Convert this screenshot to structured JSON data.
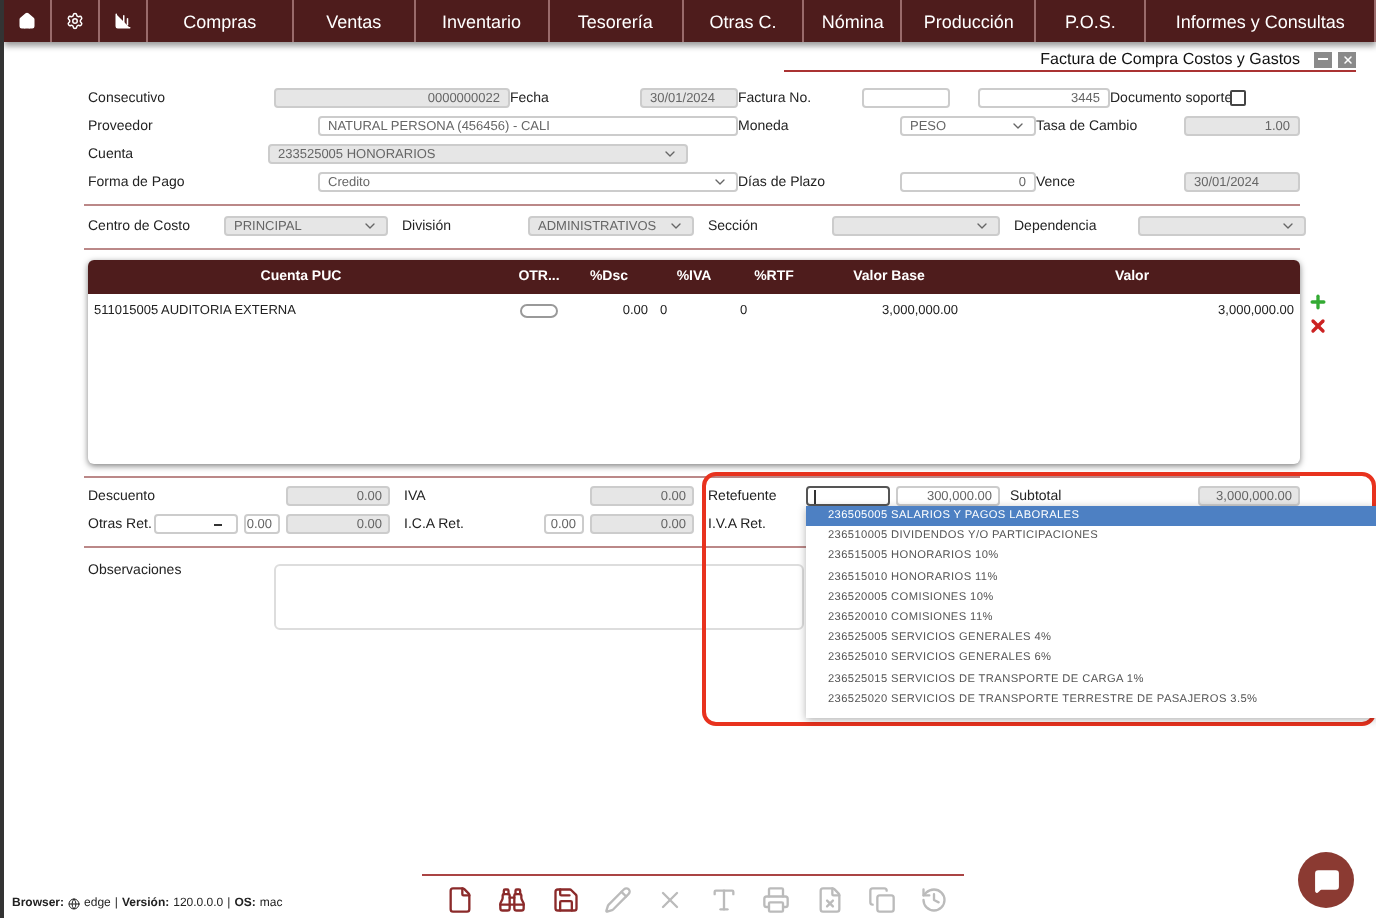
{
  "nav": {
    "items": [
      {
        "label": "Compras"
      },
      {
        "label": "Ventas"
      },
      {
        "label": "Inventario"
      },
      {
        "label": "Tesorería"
      },
      {
        "label": "Otras C."
      },
      {
        "label": "Nómina"
      },
      {
        "label": "Producción"
      },
      {
        "label": "P.O.S."
      },
      {
        "label": "Informes y Consultas"
      }
    ]
  },
  "window": {
    "title": "Factura de Compra Costos y Gastos"
  },
  "header_rows": [
    [
      {
        "kind": "label",
        "text": "Consecutivo"
      },
      {
        "kind": "input",
        "value": "0000000022",
        "disabled": true
      },
      {
        "kind": "label",
        "text": "Fecha"
      },
      {
        "kind": "input",
        "value": "30/01/2024",
        "disabled": true
      },
      {
        "kind": "label",
        "text": "Factura No."
      },
      {
        "kind": "input",
        "disabled": false
      },
      {
        "kind": "input",
        "value": "3445",
        "disabled": false
      },
      {
        "kind": "label",
        "text": "Documento soporte"
      },
      {
        "kind": "checkbox",
        "checked": false
      }
    ],
    [
      {
        "kind": "label",
        "text": "Proveedor"
      },
      {
        "kind": "input",
        "value": "NATURAL  PERSONA  (456456) - CALI",
        "disabled": false
      },
      {
        "kind": "label",
        "text": "Moneda"
      },
      {
        "kind": "select",
        "value": "PESO",
        "disabled": false
      },
      {
        "kind": "label",
        "text": "Tasa de Cambio"
      },
      {
        "kind": "input",
        "value": "1.00",
        "disabled": true
      }
    ],
    [
      {
        "kind": "label",
        "text": "Cuenta"
      },
      {
        "kind": "select",
        "value": "233525005 HONORARIOS",
        "disabled": true
      }
    ],
    [
      {
        "kind": "label",
        "text": "Forma de Pago"
      },
      {
        "kind": "select",
        "value": "Credito",
        "disabled": false
      },
      {
        "kind": "label",
        "text": "Días de Plazo"
      },
      {
        "kind": "input",
        "value": "0",
        "disabled": false
      },
      {
        "kind": "label",
        "text": "Vence"
      },
      {
        "kind": "input",
        "value": "30/01/2024",
        "disabled": true
      }
    ]
  ],
  "cost_row": [
    {
      "label": "Centro de Costo",
      "value": "PRINCIPAL"
    },
    {
      "label": "División",
      "value": "ADMINISTRATIVOS"
    },
    {
      "label": "Sección"
    },
    {
      "label": "Dependencia"
    }
  ],
  "table": {
    "columns": [
      "Cuenta PUC",
      "OTR...",
      "%Dsc",
      "%IVA",
      "%RTF",
      "Valor Base",
      "Valor"
    ],
    "rows": [
      [
        "511015005 AUDITORIA EXTERNA",
        "",
        "0.00",
        "0",
        "0",
        "3,000,000.00",
        "3,000,000.00"
      ]
    ]
  },
  "totals": {
    "descuento": {
      "label": "Descuento",
      "value": "0.00"
    },
    "iva": {
      "label": "IVA",
      "value": "0.00"
    },
    "otras_ret": {
      "label": "Otras Ret.",
      "percent": "0.00",
      "value": "0.00"
    },
    "ica_ret": {
      "label": "I.C.A Ret.",
      "percent": "0.00",
      "value": "0.00"
    },
    "retefuente": {
      "label": "Retefuente",
      "value": "300,000.00"
    },
    "iva_ret": {
      "label": "I.V.A Ret."
    },
    "subtotal": {
      "label": "Subtotal",
      "value": "3,000,000.00"
    }
  },
  "observaciones": {
    "label": "Observaciones"
  },
  "dropdown": [
    {
      "label": "236505005 SALARIOS Y PAGOS LABORALES",
      "selected": true
    },
    {
      "label": "236510005 DIVIDENDOS Y/O PARTICIPACIONES",
      "selected": false
    },
    {
      "label": "236515005 HONORARIOS 10%",
      "selected": false
    },
    {
      "label": "236515010 HONORARIOS 11%",
      "selected": false
    },
    {
      "label": "236520005 COMISIONES 10%",
      "selected": false
    },
    {
      "label": "236520010 COMISIONES 11%",
      "selected": false
    },
    {
      "label": "236525005 SERVICIOS GENERALES 4%",
      "selected": false
    },
    {
      "label": "236525010 SERVICIOS GENERALES 6%",
      "selected": false
    },
    {
      "label": "236525015 SERVICIOS DE TRANSPORTE DE CARGA 1%",
      "selected": false
    },
    {
      "label": "236525020 SERVICIOS DE TRANSPORTE TERRESTRE DE PASAJEROS 3.5%",
      "selected": false
    }
  ],
  "status": {
    "browser_label": "Browser:",
    "browser": "edge",
    "version_label": "Versión:",
    "version": "120.0.0.0",
    "os_label": "OS:",
    "os": "mac",
    "separator": "|"
  },
  "toolbar": [
    {
      "kind": "new",
      "disabled": false
    },
    {
      "kind": "find",
      "disabled": false
    },
    {
      "kind": "save",
      "disabled": false
    },
    {
      "kind": "edit",
      "disabled": true
    },
    {
      "kind": "delete",
      "disabled": true
    },
    {
      "kind": "text",
      "disabled": true
    },
    {
      "kind": "print",
      "disabled": true
    },
    {
      "kind": "excel",
      "disabled": true
    },
    {
      "kind": "copy",
      "disabled": true
    },
    {
      "kind": "history",
      "disabled": true
    }
  ]
}
